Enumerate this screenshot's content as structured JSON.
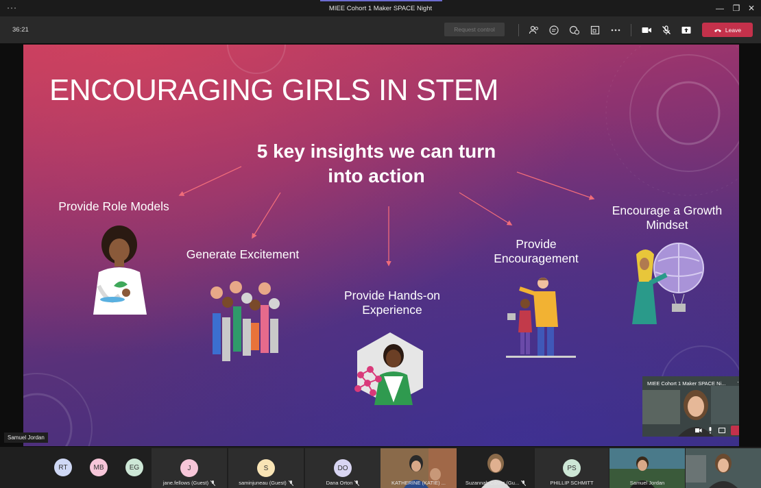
{
  "window": {
    "title": "MIEE Cohort 1 Maker SPACE Night",
    "more": "···"
  },
  "toolbar": {
    "timer": "36:21",
    "request_control": "Request control",
    "leave": "Leave"
  },
  "slide": {
    "title": "ENCOURAGING GIRLS IN STEM",
    "subtitle_line1": "5 key insights we can turn",
    "subtitle_line2": "into action",
    "insight1": "Provide Role Models",
    "insight2": "Generate Excitement",
    "insight3_line1": "Provide Hands-on",
    "insight3_line2": "Experience",
    "insight4_line1": "Provide",
    "insight4_line2": "Encouragement",
    "insight5_line1": "Encourage a Growth",
    "insight5_line2": "Mindset"
  },
  "speaker": "Samuel Jordan",
  "preview": {
    "title": "MIEE Cohort 1 Maker SPACE Ni..."
  },
  "participants": {
    "avatars": [
      {
        "initials": "RT",
        "color": "#cfd8f5"
      },
      {
        "initials": "MB",
        "color": "#f7c6d9"
      },
      {
        "initials": "EG",
        "color": "#cde7d6"
      }
    ],
    "tiles": [
      {
        "initials": "J",
        "name": "jane.fellows (Guest)",
        "color": "#f7c6d9"
      },
      {
        "initials": "S",
        "name": "saminjuneau (Guest)",
        "color": "#f9e4b5"
      },
      {
        "initials": "DO",
        "name": "Dana Orton",
        "color": "#d8d5f2"
      },
      {
        "name": "KATHERINE (KATIE) ..."
      },
      {
        "name": "Suzannah Calver (Gu..."
      },
      {
        "initials": "PS",
        "name": "PHILLIP SCHMITT",
        "color": "#cde7d6"
      },
      {
        "name": "Samuel Jordan"
      },
      {
        "name": ""
      }
    ]
  }
}
